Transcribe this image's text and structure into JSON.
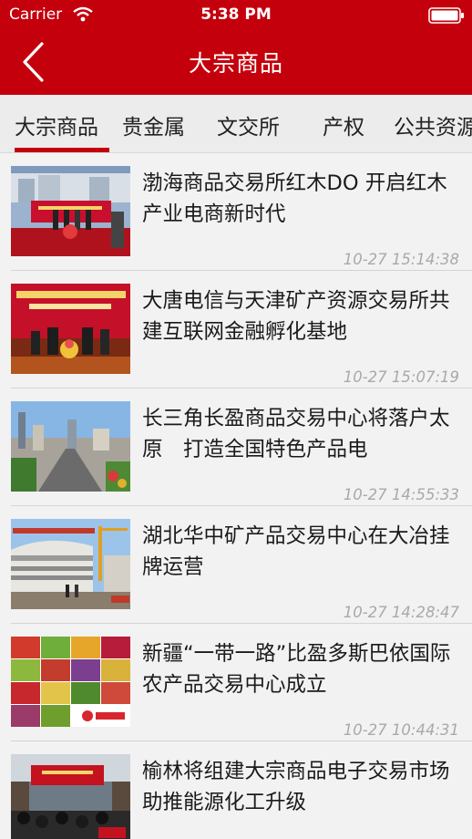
{
  "status_bar": {
    "carrier": "Carrier",
    "time": "5:38 PM"
  },
  "nav": {
    "title": "大宗商品"
  },
  "tabs": [
    {
      "label": "大宗商品"
    },
    {
      "label": "贵金属"
    },
    {
      "label": "文交所"
    },
    {
      "label": "产权"
    },
    {
      "label": "公共资源"
    }
  ],
  "news": [
    {
      "title": "渤海商品交易所红木DO 开启红木产业电商新时代",
      "time": "10-27 15:14:38"
    },
    {
      "title": "大唐电信与天津矿产资源交易所共建互联网金融孵化基地",
      "time": "10-27 15:07:19"
    },
    {
      "title": "长三角长盈商品交易中心将落户太原　打造全国特色产品电",
      "time": "10-27 14:55:33"
    },
    {
      "title": "湖北华中矿产品交易中心在大冶挂牌运营",
      "time": "10-27 14:28:47"
    },
    {
      "title": "新疆“一带一路”比盈多斯巴依国际农产品交易中心成立",
      "time": "10-27 10:44:31"
    },
    {
      "title": "榆林将组建大宗商品电子交易市场 助推能源化工升级",
      "time": ""
    }
  ],
  "colors": {
    "brand": "#c4000c",
    "timestamp": "#a9a9a9"
  }
}
